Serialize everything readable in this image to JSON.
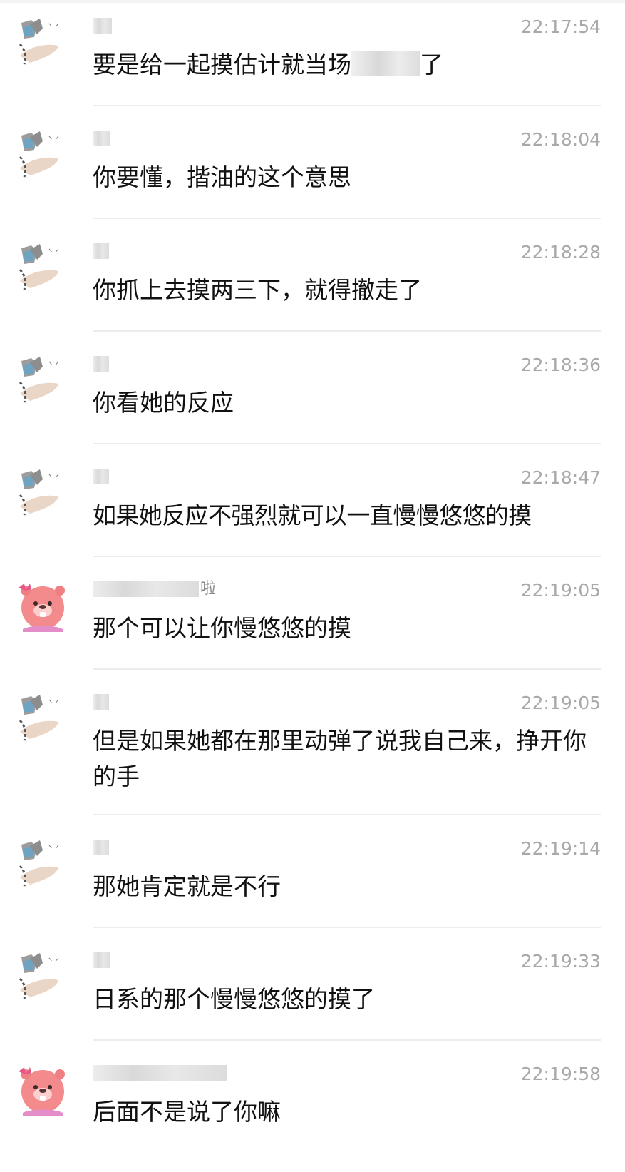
{
  "messages": [
    {
      "avatar": "cat-hug-sticker-avatar",
      "sender_visible": "",
      "time": "22:17:54",
      "text": "要是给一起摸估计就当场",
      "text_tail": "了"
    },
    {
      "avatar": "cat-hug-sticker-avatar",
      "sender_visible": "",
      "time": "22:18:04",
      "text": "你要懂，揩油的这个意思"
    },
    {
      "avatar": "cat-hug-sticker-avatar",
      "sender_visible": "",
      "time": "22:18:28",
      "text": "你抓上去摸两三下，就得撤走了"
    },
    {
      "avatar": "cat-hug-sticker-avatar",
      "sender_visible": "",
      "time": "22:18:36",
      "text": "你看她的反应"
    },
    {
      "avatar": "cat-hug-sticker-avatar",
      "sender_visible": "",
      "time": "22:18:47",
      "text": "如果她反应不强烈就可以一直慢慢悠悠的摸"
    },
    {
      "avatar": "pink-beaver-avatar",
      "sender_visible": "啦",
      "time": "22:19:05",
      "text": "那个可以让你慢悠悠的摸"
    },
    {
      "avatar": "cat-hug-sticker-avatar",
      "sender_visible": "",
      "time": "22:19:05",
      "text": "但是如果她都在那里动弹了说我自己来，挣开你的手"
    },
    {
      "avatar": "cat-hug-sticker-avatar",
      "sender_visible": "",
      "time": "22:19:14",
      "text": "那她肯定就是不行"
    },
    {
      "avatar": "cat-hug-sticker-avatar",
      "sender_visible": "",
      "time": "22:19:33",
      "text": "日系的那个慢慢悠悠的摸了"
    },
    {
      "avatar": "pink-beaver-avatar",
      "sender_visible": "",
      "time": "22:19:58",
      "text": "后面不是说了你嘛"
    }
  ]
}
